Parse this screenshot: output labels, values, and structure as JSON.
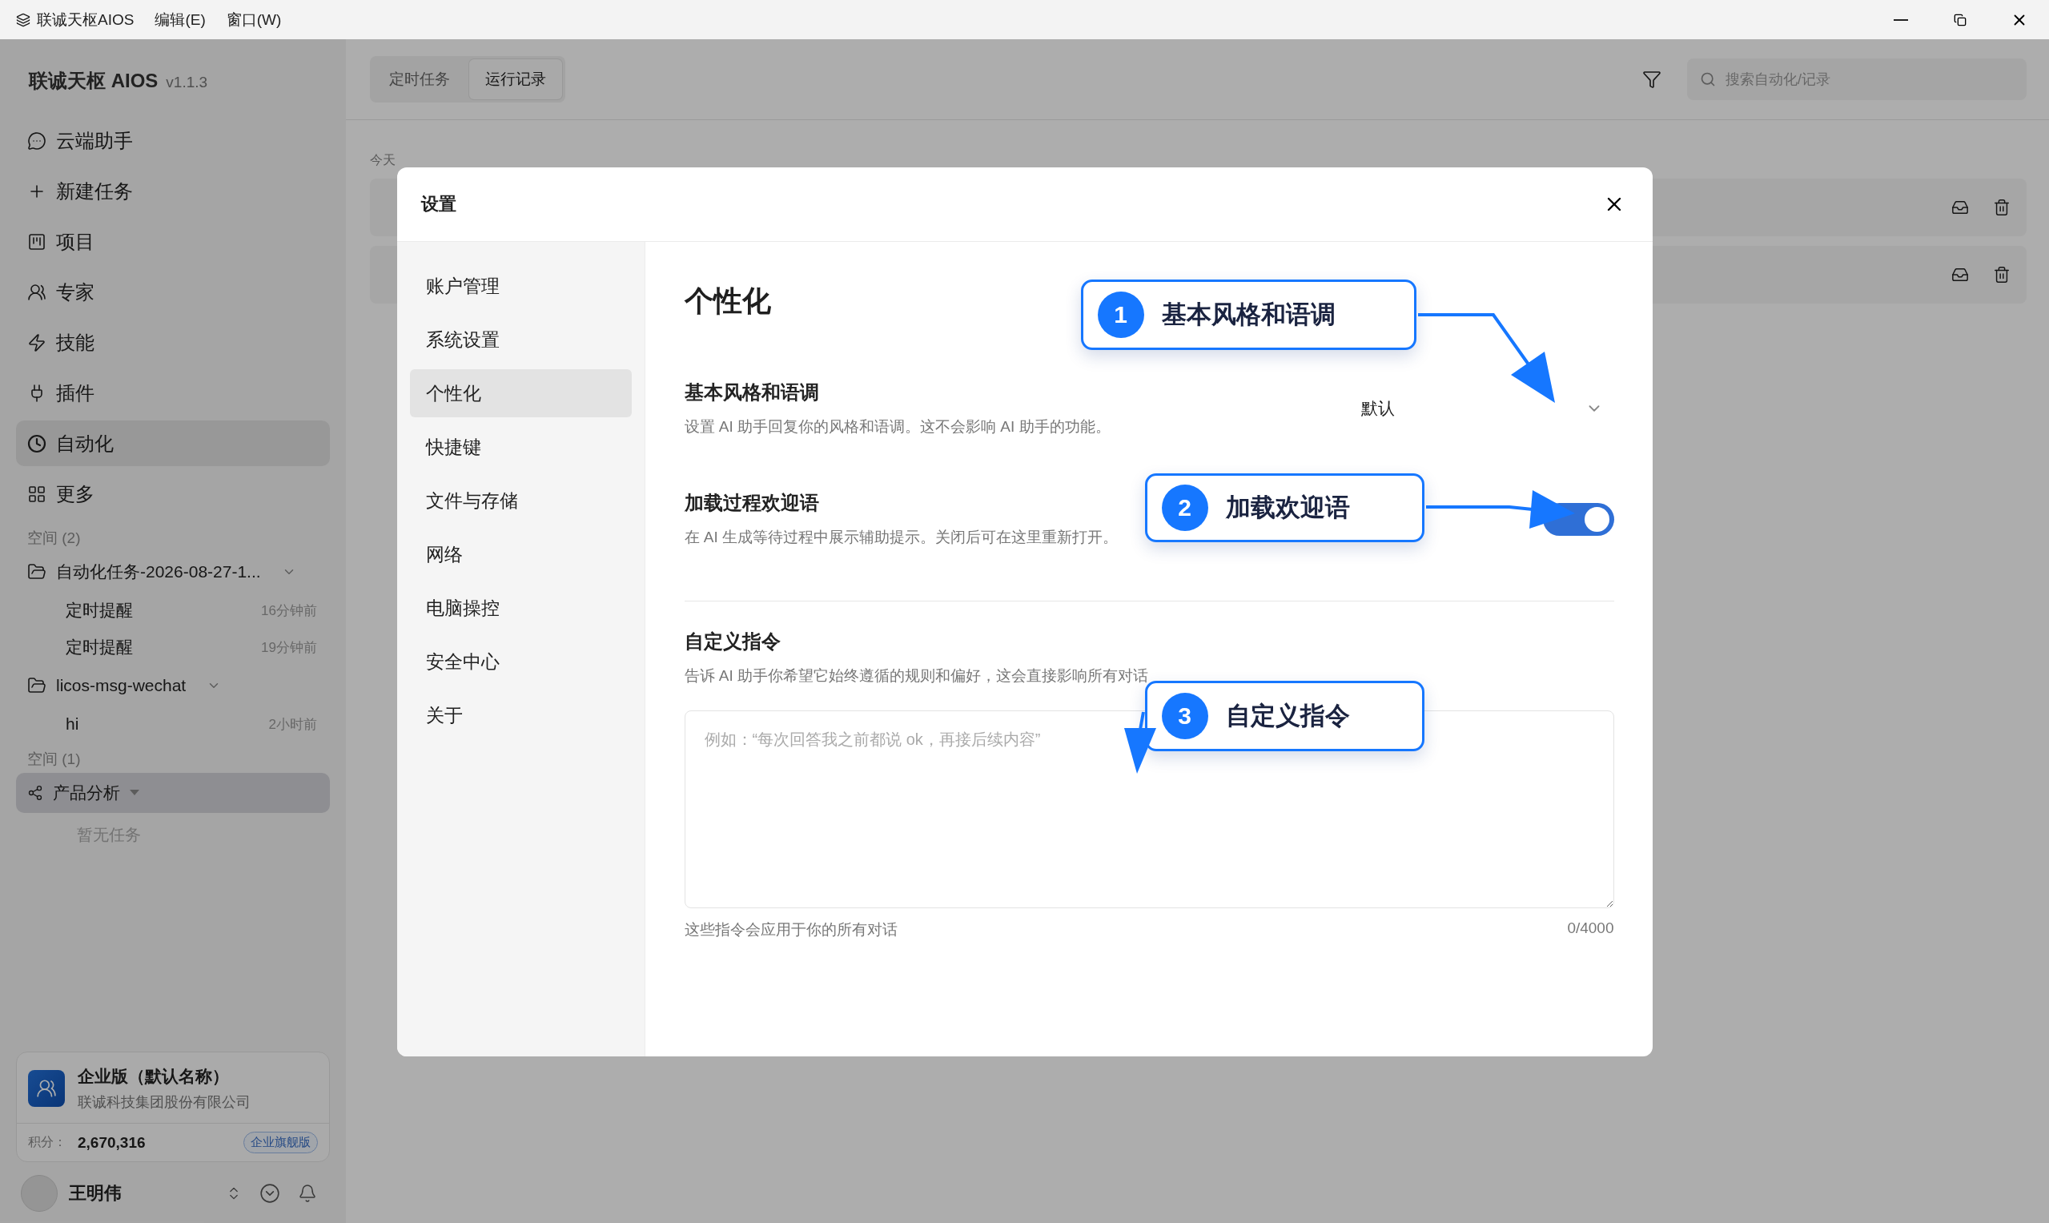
{
  "titlebar": {
    "menus": [
      "联诚天枢AIOS",
      "编辑(E)",
      "窗口(W)"
    ]
  },
  "sidebar": {
    "brand": "联诚天枢 AIOS",
    "version": "v1.1.3",
    "nav": [
      {
        "label": "云端助手",
        "selected": false
      },
      {
        "label": "新建任务",
        "selected": false
      },
      {
        "label": "项目",
        "selected": false
      },
      {
        "label": "专家",
        "selected": false
      },
      {
        "label": "技能",
        "selected": false
      },
      {
        "label": "插件",
        "selected": false
      },
      {
        "label": "自动化",
        "selected": true
      },
      {
        "label": "更多",
        "selected": false
      }
    ],
    "spaces": [
      {
        "label": "空间 (2)",
        "groups": [
          {
            "kind": "folder",
            "name": "自动化任务-2026-08-27-1...",
            "selected": false,
            "tasks": [
              {
                "name": "定时提醒",
                "time": "16分钟前"
              },
              {
                "name": "定时提醒",
                "time": "19分钟前"
              }
            ]
          },
          {
            "kind": "folder",
            "name": "licos-msg-wechat",
            "selected": false,
            "tasks": [
              {
                "name": "hi",
                "time": "2小时前"
              }
            ]
          }
        ]
      },
      {
        "label": "空间 (1)",
        "groups": [
          {
            "kind": "project",
            "name": "产品分析",
            "selected": true,
            "empty": "暂无任务"
          }
        ]
      }
    ],
    "account": {
      "plan": "企业版（默认名称）",
      "company": "联诚科技集团股份有限公司",
      "points_label": "积分：",
      "points": "2,670,316",
      "badge": "企业旗舰版"
    },
    "user": {
      "name": "王明伟"
    }
  },
  "main": {
    "tabs": [
      {
        "label": "定时任务",
        "selected": false
      },
      {
        "label": "运行记录",
        "selected": true
      }
    ],
    "search": {
      "placeholder": "搜索自动化/记录"
    },
    "group_label": "今天",
    "rows": [
      {},
      {}
    ]
  },
  "dialog": {
    "title": "设置",
    "nav": [
      {
        "label": "账户管理",
        "selected": false
      },
      {
        "label": "系统设置",
        "selected": false
      },
      {
        "label": "个性化",
        "selected": true
      },
      {
        "label": "快捷键",
        "selected": false
      },
      {
        "label": "文件与存储",
        "selected": false
      },
      {
        "label": "网络",
        "selected": false
      },
      {
        "label": "电脑操控",
        "selected": false
      },
      {
        "label": "安全中心",
        "selected": false
      },
      {
        "label": "关于",
        "selected": false
      }
    ],
    "heading": "个性化",
    "settings": [
      {
        "kind": "select",
        "title": "基本风格和语调",
        "description": "设置 AI 助手回复你的风格和语调。这不会影响 AI 助手的功能。",
        "value": "默认"
      },
      {
        "kind": "toggle",
        "title": "加载过程欢迎语",
        "description": "在 AI 生成等待过程中展示辅助提示。关闭后可在这里重新打开。",
        "on": true
      }
    ],
    "custom": {
      "title": "自定义指令",
      "description": "告诉 AI 助手你希望它始终遵循的规则和偏好，这会直接影响所有对话",
      "placeholder": "例如：“每次回答我之前都说 ok，再接后续内容”",
      "hint": "这些指令会应用于你的所有对话",
      "counter": "0/4000"
    },
    "callouts": [
      {
        "number": "1",
        "label": "基本风格和语调"
      },
      {
        "number": "2",
        "label": "加载欢迎语"
      },
      {
        "number": "3",
        "label": "自定义指令"
      }
    ]
  }
}
